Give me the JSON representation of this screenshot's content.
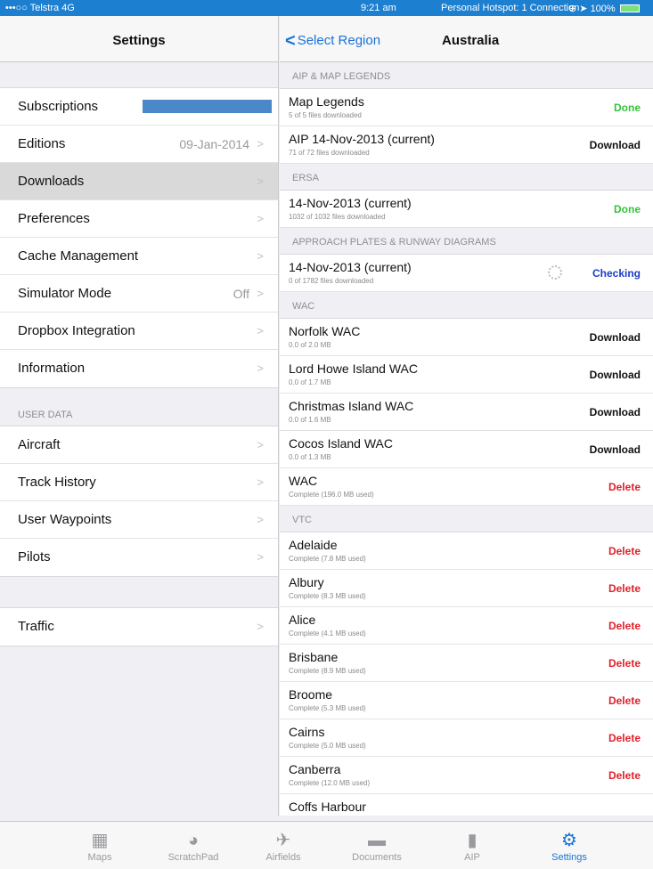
{
  "status": {
    "carrier": "•••○○ Telstra  4G",
    "time": "9:21 am",
    "hotspot": "Personal Hotspot: 1 Connection",
    "battery": "100%"
  },
  "left": {
    "title": "Settings",
    "rows1": [
      {
        "label": "Subscriptions",
        "value": ""
      },
      {
        "label": "Editions",
        "value": "09-Jan-2014"
      },
      {
        "label": "Downloads",
        "value": ""
      },
      {
        "label": "Preferences",
        "value": ""
      },
      {
        "label": "Cache Management",
        "value": ""
      },
      {
        "label": "Simulator Mode",
        "value": "Off"
      },
      {
        "label": "Dropbox Integration",
        "value": ""
      },
      {
        "label": "Information",
        "value": ""
      }
    ],
    "user_data_label": "USER DATA",
    "rows2": [
      {
        "label": "Aircraft"
      },
      {
        "label": "Track History"
      },
      {
        "label": "User Waypoints"
      },
      {
        "label": "Pilots"
      }
    ],
    "rows3": [
      {
        "label": "Traffic"
      }
    ]
  },
  "right": {
    "back_label": "Select Region",
    "title": "Australia",
    "sections": [
      {
        "label": "AIP & MAP LEGENDS",
        "items": [
          {
            "name": "Map Legends",
            "sub": "5 of 5 files downloaded",
            "action": "Done"
          },
          {
            "name": "AIP 14-Nov-2013 (current)",
            "sub": "71 of 72 files downloaded",
            "action": "Download"
          }
        ]
      },
      {
        "label": "ERSA",
        "items": [
          {
            "name": "14-Nov-2013 (current)",
            "sub": "1032 of 1032 files downloaded",
            "action": "Done"
          }
        ]
      },
      {
        "label": "APPROACH PLATES & RUNWAY DIAGRAMS",
        "items": [
          {
            "name": "14-Nov-2013 (current)",
            "sub": "0 of 1782 files downloaded",
            "action": "Checking"
          }
        ]
      },
      {
        "label": "WAC",
        "items": [
          {
            "name": "Norfolk WAC",
            "sub": "0.0 of 2.0 MB",
            "action": "Download"
          },
          {
            "name": "Lord Howe Island WAC",
            "sub": "0.0 of 1.7 MB",
            "action": "Download"
          },
          {
            "name": "Christmas Island WAC",
            "sub": "0.0 of 1.6 MB",
            "action": "Download"
          },
          {
            "name": "Cocos Island WAC",
            "sub": "0.0 of 1.3 MB",
            "action": "Download"
          },
          {
            "name": "WAC",
            "sub": "Complete (196.0 MB used)",
            "action": "Delete"
          }
        ]
      },
      {
        "label": "VTC",
        "items": [
          {
            "name": "Adelaide",
            "sub": "Complete (7.8 MB used)",
            "action": "Delete"
          },
          {
            "name": "Albury",
            "sub": "Complete (8.3 MB used)",
            "action": "Delete"
          },
          {
            "name": "Alice",
            "sub": "Complete (4.1 MB used)",
            "action": "Delete"
          },
          {
            "name": "Brisbane",
            "sub": "Complete (8.9 MB used)",
            "action": "Delete"
          },
          {
            "name": "Broome",
            "sub": "Complete (5.3 MB used)",
            "action": "Delete"
          },
          {
            "name": "Cairns",
            "sub": "Complete (5.0 MB used)",
            "action": "Delete"
          },
          {
            "name": "Canberra",
            "sub": "Complete (12.0 MB used)",
            "action": "Delete"
          },
          {
            "name": "Coffs Harbour",
            "sub": "",
            "action": ""
          }
        ]
      }
    ]
  },
  "tabs": [
    {
      "label": "Maps",
      "icon": "map-icon"
    },
    {
      "label": "ScratchPad",
      "icon": "palette-icon"
    },
    {
      "label": "Airfields",
      "icon": "airplane-icon"
    },
    {
      "label": "Documents",
      "icon": "folder-icon"
    },
    {
      "label": "AIP",
      "icon": "book-icon"
    },
    {
      "label": "Settings",
      "icon": "gear-icon"
    }
  ],
  "colors": {
    "accent": "#1a73d6",
    "done": "#35c33b",
    "delete": "#e0202a",
    "checking": "#1a3ec7",
    "statusbar": "#1d7fd0"
  }
}
